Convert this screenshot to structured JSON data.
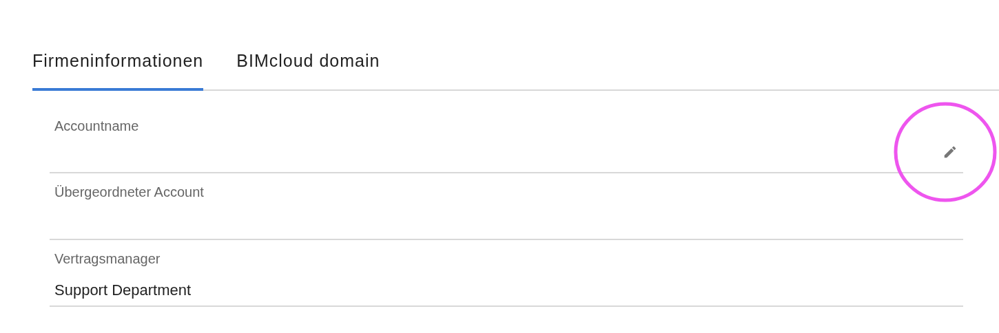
{
  "tabs": [
    {
      "label": "Firmeninformationen",
      "selected": true
    },
    {
      "label": "BIMcloud domain",
      "selected": false
    }
  ],
  "fields": [
    {
      "label": "Accountname",
      "editable": true
    },
    {
      "label": "Übergeordneter Account",
      "editable": false
    },
    {
      "label": "Vertragsmanager",
      "value": "Support Department",
      "editable": false
    }
  ]
}
